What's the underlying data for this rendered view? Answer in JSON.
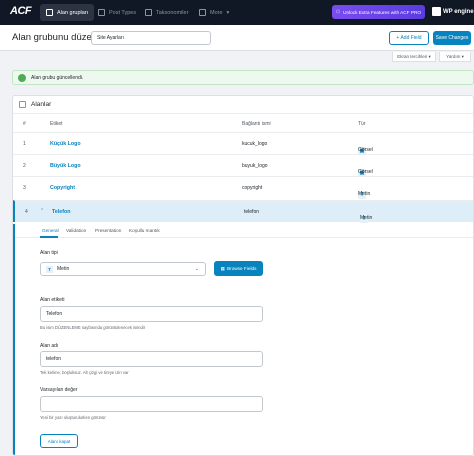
{
  "topbar": {
    "logo": "ACF",
    "nav": [
      {
        "label": "Alan grupları",
        "icon": "field-groups-icon",
        "active": true
      },
      {
        "label": "Post Types",
        "icon": "post-types-icon",
        "active": false
      },
      {
        "label": "Taksonomiler",
        "icon": "taxonomies-icon",
        "active": false
      },
      {
        "label": "More",
        "icon": "more-icon",
        "active": false
      }
    ],
    "unlock_label": "Unlock Extra Features with ACF PRO",
    "brand": "WP engine"
  },
  "header": {
    "title": "Alan grubunu düzenle",
    "group_name": "Site Ayarları",
    "add_field_label": "+ Add Field",
    "save_label": "Save Changes"
  },
  "screen_options": "Ekran tercihleri ▾",
  "help": "Yardım ▾",
  "notice": "Alan grubu güncellendi.",
  "panel": {
    "title": "Alanlar",
    "columns": [
      "#",
      "Etiket",
      "Bağlantı ismi",
      "Tür"
    ],
    "rows": [
      {
        "num": "1",
        "label": "Küçük Logo",
        "name": "kucuk_logo",
        "type": "Görsel",
        "type_icon": "image-icon"
      },
      {
        "num": "2",
        "label": "Büyük Logo",
        "name": "buyuk_logo",
        "type": "Görsel",
        "type_icon": "image-icon"
      },
      {
        "num": "3",
        "label": "Copyright",
        "name": "copyright",
        "type": "Metin",
        "type_icon": "text-icon"
      },
      {
        "num": "4",
        "label": "Telefon",
        "name": "telefon",
        "type": "Metin",
        "type_icon": "text-icon"
      }
    ]
  },
  "detail": {
    "tabs": [
      "General",
      "Validation",
      "Presentation",
      "Koşullu mantık"
    ],
    "field_type_label": "Alan tipi",
    "field_type_value": "Metin",
    "browse_label": "Browse Fields",
    "field_label_label": "Alan etiketi",
    "field_label_value": "Telefon",
    "field_label_help": "Bu isim DÜZENLEME sayfasında görüntülenecek isimdir",
    "field_name_label": "Alan adı",
    "field_name_value": "telefon",
    "field_name_help": "Tek kelime, boşluksuz. Alt çizgi ve tireye izin var",
    "default_label": "Varsayılan değer",
    "default_value": "",
    "default_help": "Yeni bir yazı oluşturulurken görünür",
    "close_label": "Alanı kapat"
  }
}
